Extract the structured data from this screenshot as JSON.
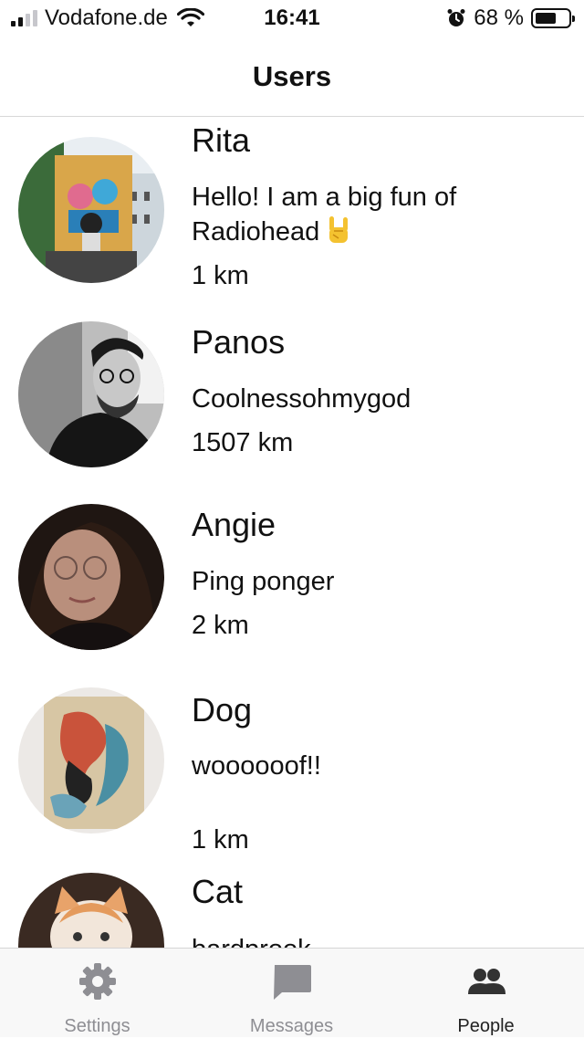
{
  "status_bar": {
    "carrier": "Vodafone.de",
    "time": "16:41",
    "battery_percent": "68 %",
    "battery_level": 0.68
  },
  "header": {
    "title": "Users"
  },
  "users": [
    {
      "name": "Rita",
      "bio": "Hello! I am a big fun of Radiohead",
      "emoji": "rock-on-hand-emoji",
      "distance": "1 km"
    },
    {
      "name": "Panos",
      "bio": "Coolnessohmygod",
      "distance": "1507 km"
    },
    {
      "name": "Angie",
      "bio": "Ping ponger",
      "distance": "2 km"
    },
    {
      "name": "Dog",
      "bio": "woooooof!!",
      "distance": "1 km"
    },
    {
      "name": "Cat",
      "bio": "bardprook",
      "distance": ""
    }
  ],
  "tab_bar": {
    "tabs": [
      {
        "label": "Settings",
        "icon": "gear-icon",
        "active": false
      },
      {
        "label": "Messages",
        "icon": "message-icon",
        "active": false
      },
      {
        "label": "People",
        "icon": "people-icon",
        "active": true
      }
    ]
  },
  "colors": {
    "accent": "#222222",
    "inactive": "#8e8e93",
    "divider": "#d8d8d8"
  }
}
